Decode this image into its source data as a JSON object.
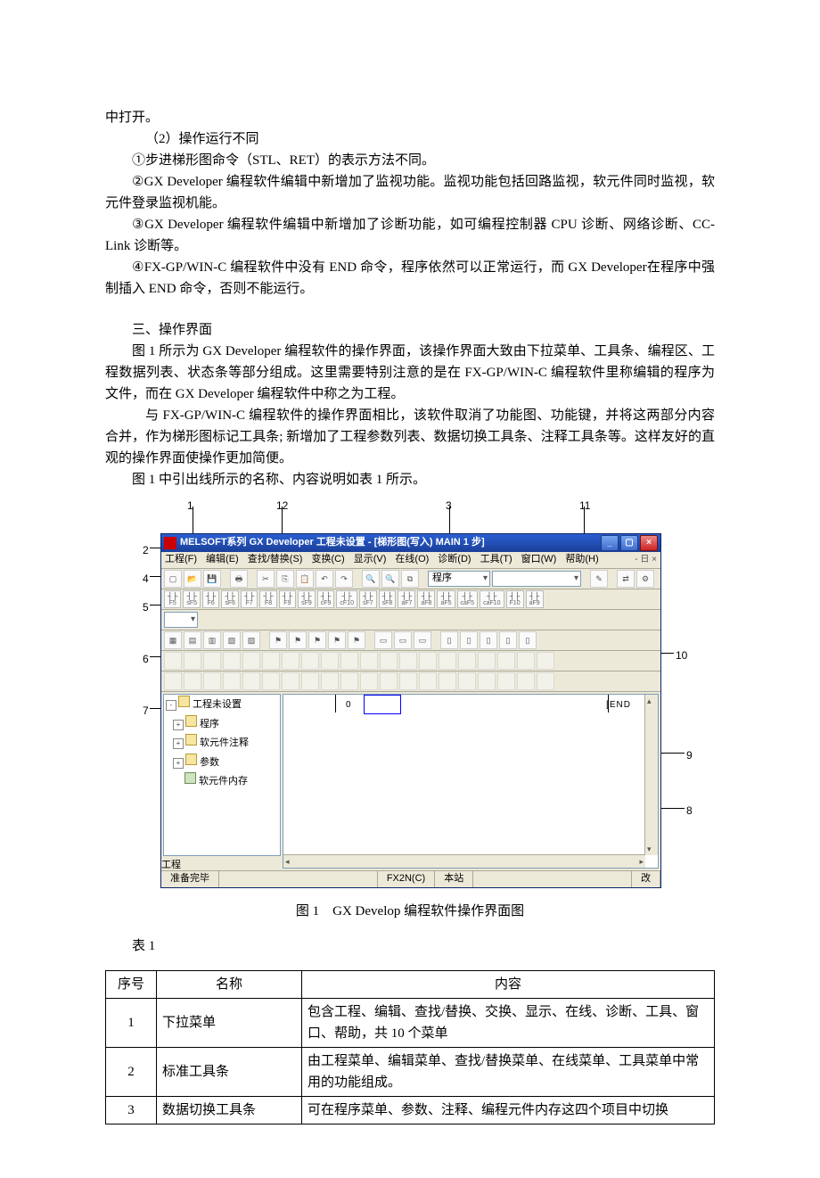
{
  "text": {
    "p_open": "中打开。",
    "p_b": "（2）操作运行不同",
    "p_c": "①步进梯形图命令（STL、RET）的表示方法不同。",
    "p_d": "②GX Developer 编程软件编辑中新增加了监视功能。监视功能包括回路监视，软元件同时监视，软元件登录监视机能。",
    "p_e": "③GX Developer 编程软件编辑中新增加了诊断功能，如可编程控制器 CPU 诊断、网络诊断、CC-Link 诊断等。",
    "p_f": "④FX-GP/WIN-C 编程软件中没有 END 命令，程序依然可以正常运行，而 GX Developer在程序中强制插入 END 命令，否则不能运行。",
    "h3": "三、操作界面",
    "p_g": "图 1 所示为 GX Developer 编程软件的操作界面，该操作界面大致由下拉菜单、工具条、编程区、工程数据列表、状态条等部分组成。这里需要特别注意的是在 FX-GP/WIN-C 编程软件里称编辑的程序为文件，而在 GX Developer 编程软件中称之为工程。",
    "p_h": "与 FX-GP/WIN-C 编程软件的操作界面相比，该软件取消了功能图、功能键，并将这两部分内容合并，作为梯形图标记工具条; 新增加了工程参数列表、数据切换工具条、注释工具条等。这样友好的直观的操作界面使操作更加简便。",
    "p_i": "图 1 中引出线所示的名称、内容说明如表 1 所示。",
    "fig_caption": "图 1　GX Develop 编程软件操作界面图",
    "tbl_label": "表 1"
  },
  "callouts": {
    "n1": "1",
    "n2": "2",
    "n3": "3",
    "n4": "4",
    "n5": "5",
    "n6": "6",
    "n7": "7",
    "n8": "8",
    "n9": "9",
    "n10": "10",
    "n11": "11",
    "n12": "12"
  },
  "app": {
    "title": "MELSOFT系列  GX Developer  工程未设置  -  [梯形图(写入)     MAIN     1 步]",
    "menus": {
      "project": "工程(F)",
      "edit": "编辑(E)",
      "find": "查找/替换(S)",
      "convert": "变换(C)",
      "view": "显示(V)",
      "online": "在线(O)",
      "diag": "诊断(D)",
      "tool": "工具(T)",
      "window": "窗口(W)",
      "help": "帮助(H)",
      "mdiclose": "- 日 ×"
    },
    "combo_prog": "程序",
    "fkeys": [
      "F5",
      "sF5",
      "F6",
      "sF6",
      "F7",
      "F8",
      "F9",
      "sF9",
      "cF9",
      "cF10",
      "sF7",
      "sF8",
      "aF7",
      "aF8",
      "aF5",
      "caF5",
      "caF10",
      "F10",
      "aF9"
    ],
    "tree": {
      "root": "工程未设置",
      "n_prog": "程序",
      "n_comment": "软元件注释",
      "n_param": "参数",
      "n_devmem": "软元件内存",
      "tab": "工程"
    },
    "ladder": {
      "row0": "0",
      "end": "[END"
    },
    "status": {
      "ready": "准备完毕",
      "cpu": "FX2N(C)",
      "station": "本站",
      "mode": "改"
    }
  },
  "table": {
    "head": {
      "c1": "序号",
      "c2": "名称",
      "c3": "内容"
    },
    "rows": [
      {
        "num": "1",
        "name": "下拉菜单",
        "desc": "包含工程、编辑、查找/替换、交换、显示、在线、诊断、工具、窗口、帮助，共 10 个菜单"
      },
      {
        "num": "2",
        "name": "标准工具条",
        "desc": "由工程菜单、编辑菜单、查找/替换菜单、在线菜单、工具菜单中常用的功能组成。"
      },
      {
        "num": "3",
        "name": "数据切换工具条",
        "desc": "可在程序菜单、参数、注释、编程元件内存这四个项目中切换"
      }
    ]
  }
}
